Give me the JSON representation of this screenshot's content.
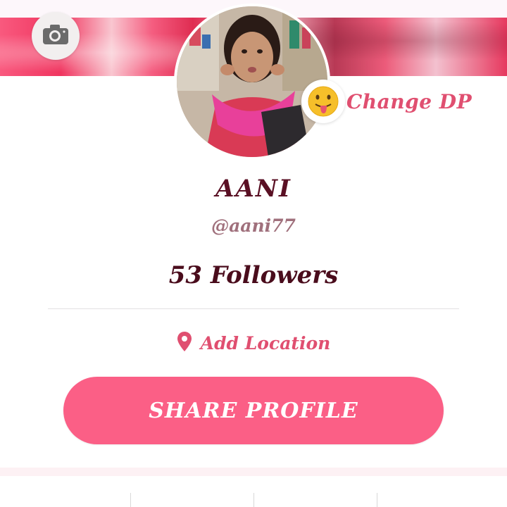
{
  "profile": {
    "name": "AANI",
    "handle": "@aani77",
    "followers": "53 Followers",
    "change_dp": "Change DP"
  },
  "location": {
    "label": "Add Location"
  },
  "actions": {
    "share_profile": "SHARE PROFILE"
  },
  "icons": {
    "camera": "camera-icon",
    "emoji": "tongue-emoji-icon",
    "location": "location-pin-icon"
  },
  "colors": {
    "accent": "#fb5f86",
    "accent_text": "#e04f70",
    "name": "#5a1024",
    "handle": "#a0707c",
    "followers": "#4a0c1c"
  }
}
